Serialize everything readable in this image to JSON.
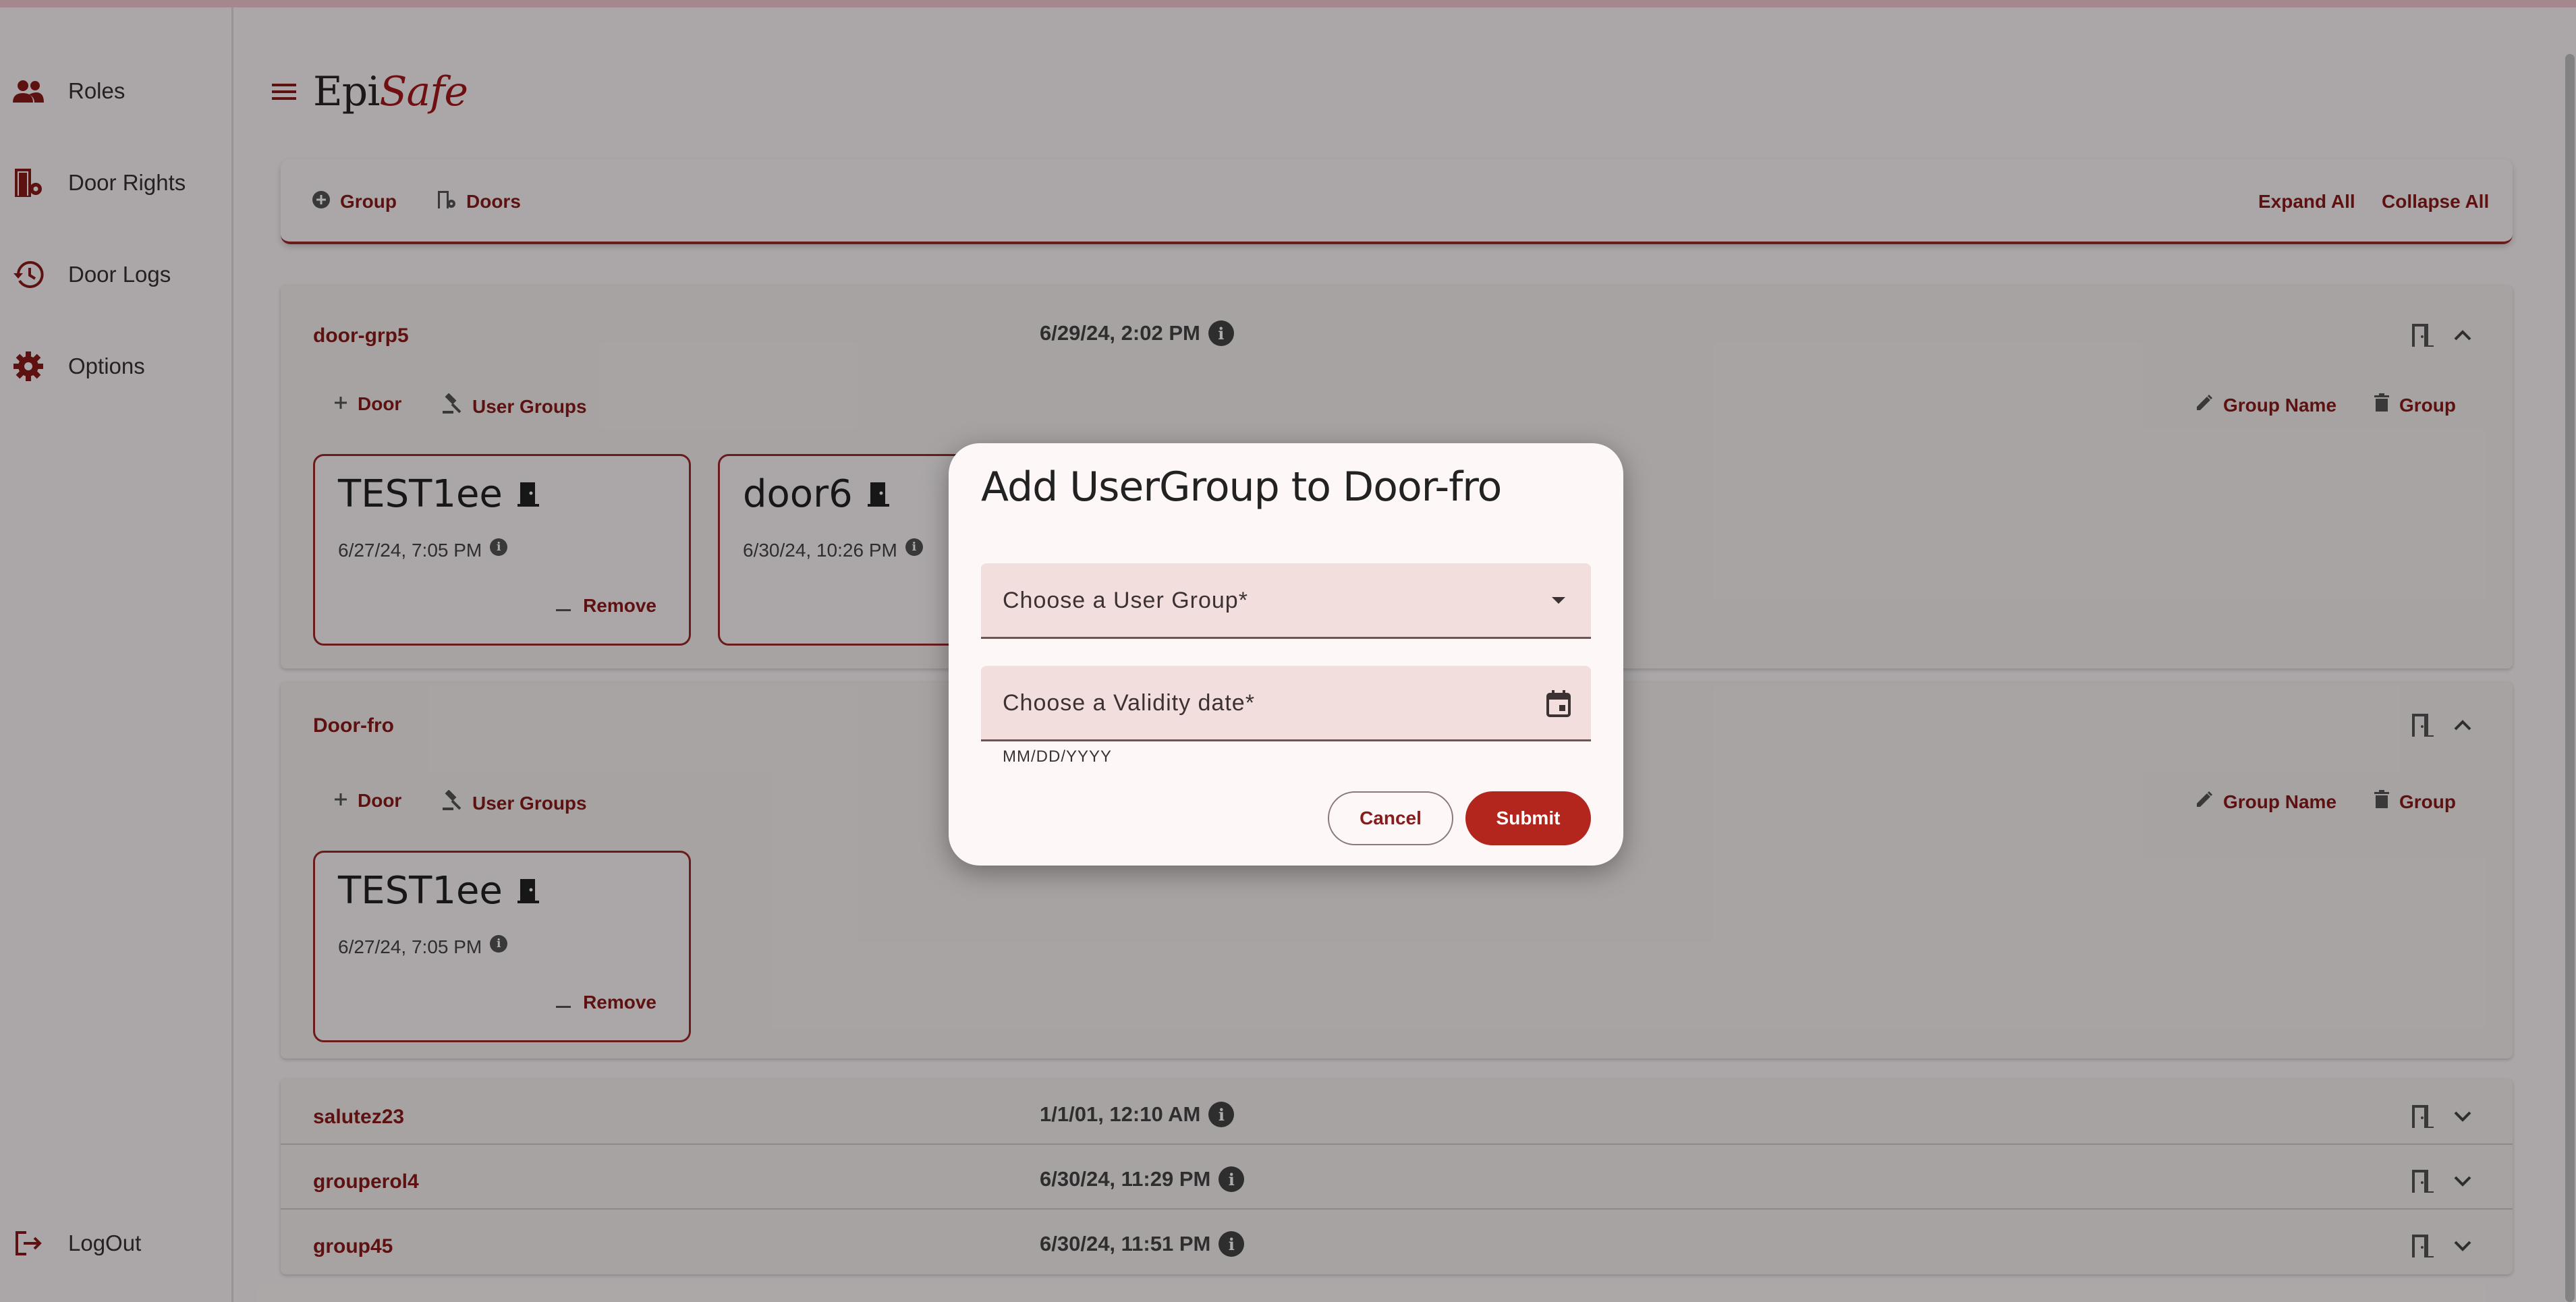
{
  "sidebar": {
    "items": [
      {
        "label": "Roles",
        "icon": "people-icon"
      },
      {
        "label": "Door Rights",
        "icon": "door-settings-icon"
      },
      {
        "label": "Door Logs",
        "icon": "history-icon"
      },
      {
        "label": "Options",
        "icon": "gear-icon"
      }
    ],
    "logout": {
      "label": "LogOut",
      "icon": "logout-icon"
    }
  },
  "header": {
    "logo_part1": "Epi",
    "logo_part2": "Safe"
  },
  "toolbar": {
    "add_group": "Group",
    "doors": "Doors",
    "expand_all": "Expand All",
    "collapse_all": "Collapse All"
  },
  "groups": [
    {
      "name": "door-grp5",
      "date": "6/29/24, 2:02 PM",
      "add_door": "Door",
      "user_groups": "User Groups",
      "edit_name": "Group Name",
      "delete": "Group",
      "doors": [
        {
          "name": "TEST1ee",
          "date": "6/27/24, 7:05 PM",
          "remove": "Remove"
        },
        {
          "name": "door6",
          "date": "6/30/24, 10:26 PM"
        }
      ]
    },
    {
      "name": "Door-fro",
      "add_door": "Door",
      "user_groups": "User Groups",
      "edit_name": "Group Name",
      "delete": "Group",
      "doors": [
        {
          "name": "TEST1ee",
          "date": "6/27/24, 7:05 PM",
          "remove": "Remove"
        }
      ]
    },
    {
      "name": "salutez23",
      "date": "1/1/01, 12:10 AM"
    },
    {
      "name": "grouperol4",
      "date": "6/30/24, 11:29 PM"
    },
    {
      "name": "group45",
      "date": "6/30/24, 11:51 PM"
    }
  ],
  "dialog": {
    "title": "Add UserGroup to Door-fro",
    "user_group_placeholder": "Choose a User Group*",
    "validity_placeholder": "Choose a Validity date*",
    "date_hint": "MM/DD/YYYY",
    "cancel": "Cancel",
    "submit": "Submit"
  },
  "colors": {
    "accent": "#8b1a1a",
    "submit": "#b3261e",
    "field_bg": "#f2dfdd"
  }
}
